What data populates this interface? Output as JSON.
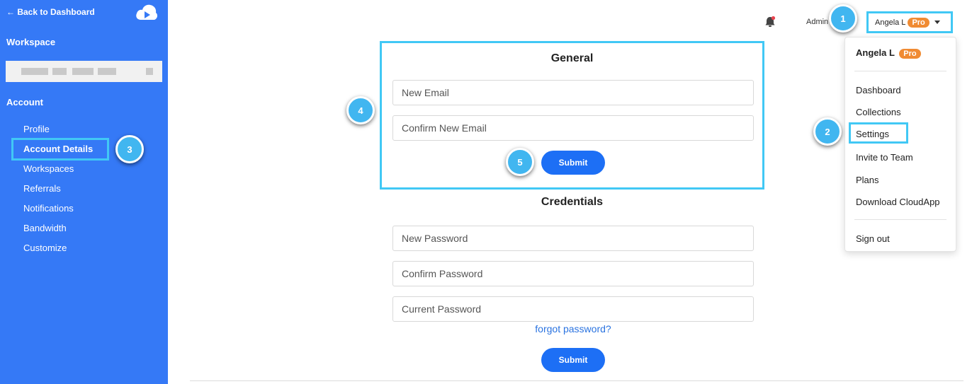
{
  "sidebar": {
    "back_label": "← Back to Dashboard",
    "workspace_heading": "Workspace",
    "account_heading": "Account",
    "items": [
      {
        "label": "Profile"
      },
      {
        "label": "Account Details"
      },
      {
        "label": "Workspaces"
      },
      {
        "label": "Referrals"
      },
      {
        "label": "Notifications"
      },
      {
        "label": "Bandwidth"
      },
      {
        "label": "Customize"
      }
    ]
  },
  "callouts": [
    "1",
    "2",
    "3",
    "4",
    "5"
  ],
  "general": {
    "title": "General",
    "email_placeholder": "New Email",
    "confirm_email_placeholder": "Confirm New Email",
    "submit_label": "Submit"
  },
  "credentials": {
    "title": "Credentials",
    "new_password_placeholder": "New Password",
    "confirm_password_placeholder": "Confirm Password",
    "current_password_placeholder": "Current Password",
    "forgot_label": "forgot password?",
    "submit_label": "Submit"
  },
  "header": {
    "admin_label": "Admin",
    "user_name": "Angela L",
    "badge": "Pro"
  },
  "menu": {
    "user_name": "Angela L",
    "badge": "Pro",
    "items": [
      {
        "label": "Dashboard"
      },
      {
        "label": "Collections"
      },
      {
        "label": "Settings"
      },
      {
        "label": "Invite to Team"
      },
      {
        "label": "Plans"
      },
      {
        "label": "Download CloudApp"
      }
    ],
    "signout_label": "Sign out"
  },
  "colors": {
    "sidebar": "#3579f6",
    "highlight": "#41c8f5",
    "button": "#1d6ff5",
    "pro_badge": "#f08b33"
  }
}
